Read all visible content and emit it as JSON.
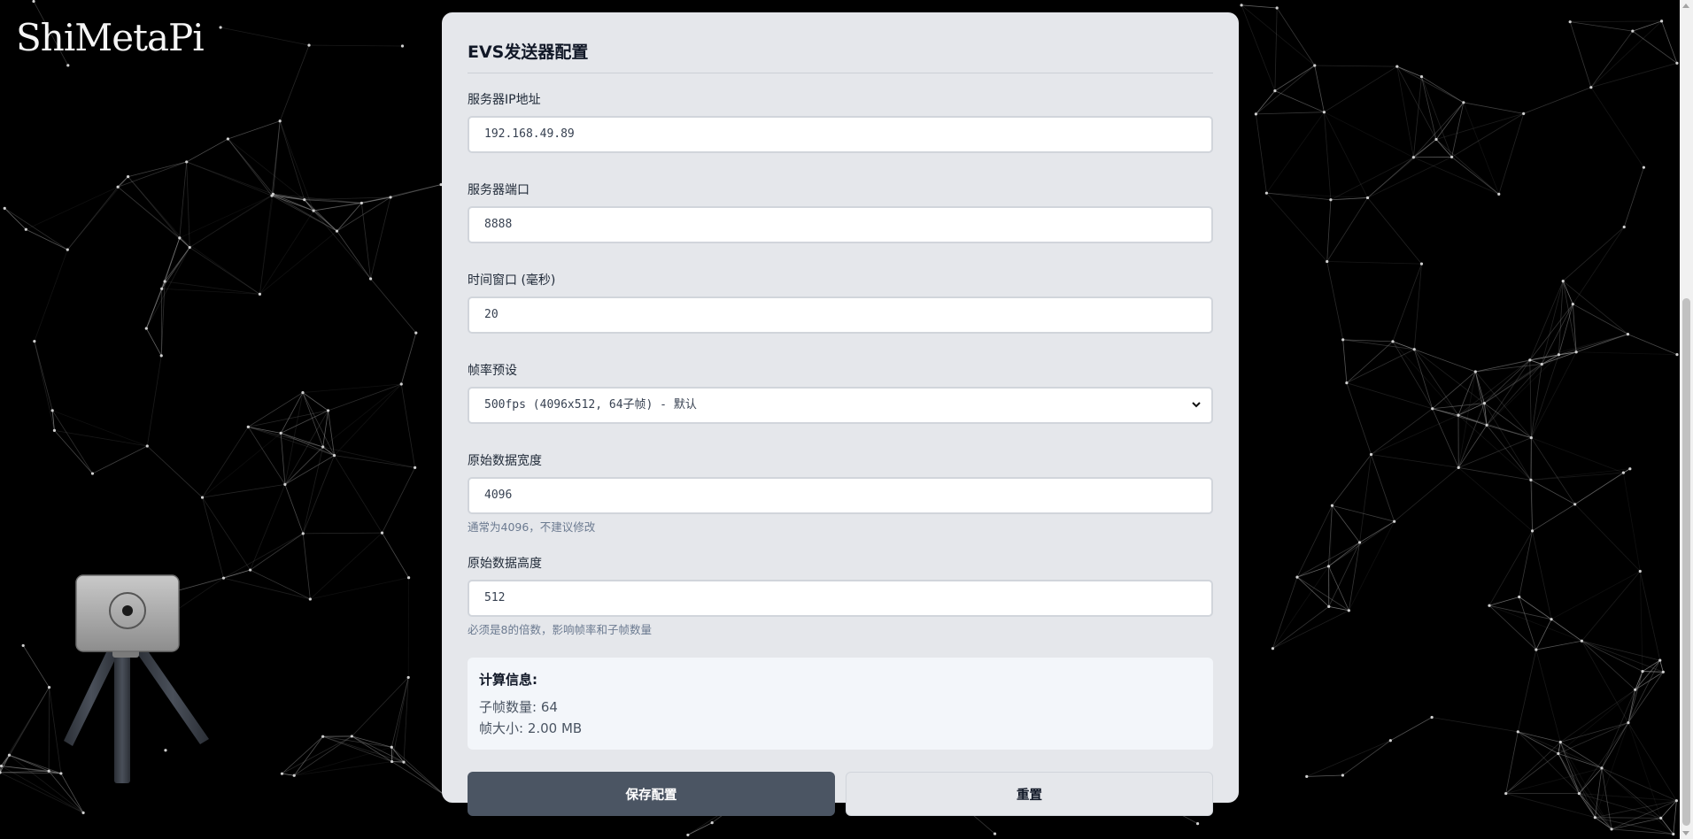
{
  "brand": {
    "logo_text": "ShiMetaPi"
  },
  "form": {
    "title": "EVS发送器配置",
    "fields": {
      "server_ip": {
        "label": "服务器IP地址",
        "value": "192.168.49.89"
      },
      "server_port": {
        "label": "服务器端口",
        "value": "8888"
      },
      "time_window": {
        "label": "时间窗口 (毫秒)",
        "value": "20"
      },
      "fps_preset": {
        "label": "帧率预设",
        "selected": "500fps (4096x512, 64子帧) - 默认"
      },
      "raw_width": {
        "label": "原始数据宽度",
        "value": "4096",
        "hint": "通常为4096，不建议修改"
      },
      "raw_height": {
        "label": "原始数据高度",
        "value": "512",
        "hint": "必须是8的倍数，影响帧率和子帧数量"
      }
    },
    "info": {
      "title": "计算信息:",
      "subframes": "子帧数量: 64",
      "frame_size": "帧大小: 2.00 MB"
    },
    "buttons": {
      "save": "保存配置",
      "reset": "重置"
    }
  },
  "colors": {
    "background": "#000000",
    "card": "#e5e7eb",
    "primary_button": "#4b5563",
    "network_lines": "#8a8a8a"
  },
  "icons": {
    "select_arrow": "chevron-down-icon",
    "device": "camera-on-tripod-icon"
  }
}
